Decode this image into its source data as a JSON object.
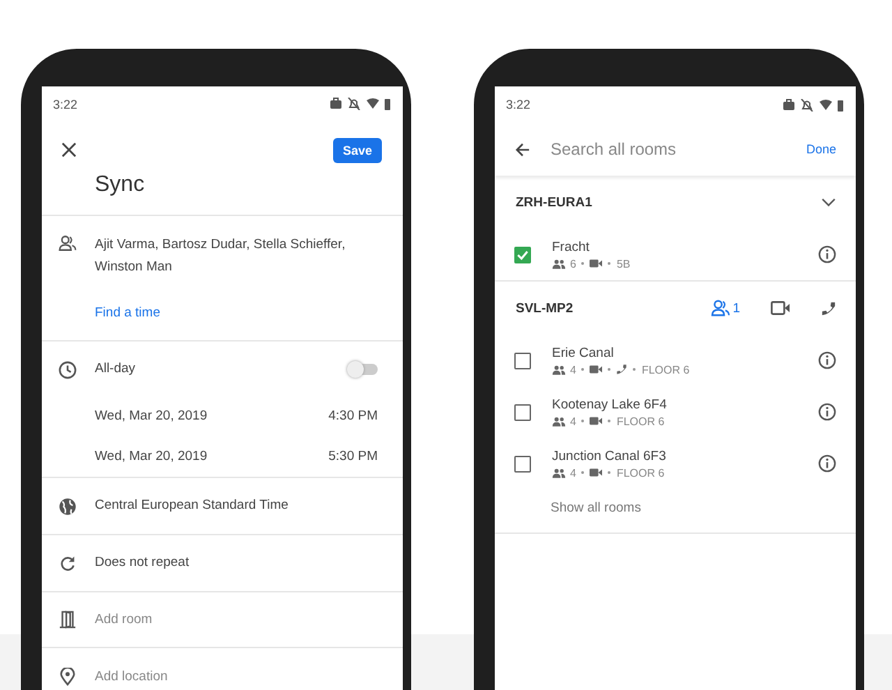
{
  "event_screen": {
    "status_time": "3:22",
    "save": "Save",
    "title": "Sync",
    "attendees": "Ajit Varma, Bartosz Dudar, Stella Schieffer, Winston Man",
    "find_time": "Find a time",
    "all_day": {
      "label": "All-day",
      "on": false
    },
    "start": {
      "date": "Wed, Mar 20, 2019",
      "time": "4:30 PM"
    },
    "end": {
      "date": "Wed, Mar 20, 2019",
      "time": "5:30 PM"
    },
    "timezone": "Central European Standard Time",
    "repeat": "Does not repeat",
    "room": {
      "placeholder": "Add room"
    },
    "location": {
      "placeholder": "Add location"
    }
  },
  "rooms_screen": {
    "status_time": "3:22",
    "search": {
      "placeholder": "Search all rooms"
    },
    "done": "Done",
    "groups": [
      {
        "name": "ZRH-EURA1",
        "kind": "collapsible",
        "rooms": [
          {
            "name": "Fracht",
            "checked": true,
            "capacity": "6",
            "video": true,
            "phone": false,
            "location": "5B"
          }
        ]
      },
      {
        "name": "SVL-MP2",
        "kind": "actions",
        "guest_count": "1",
        "rooms": [
          {
            "name": "Erie Canal",
            "checked": false,
            "capacity": "4",
            "video": true,
            "phone": true,
            "location": "FLOOR 6"
          },
          {
            "name": "Kootenay Lake 6F4",
            "checked": false,
            "capacity": "4",
            "video": true,
            "phone": false,
            "location": "FLOOR 6"
          },
          {
            "name": "Junction Canal 6F3",
            "checked": false,
            "capacity": "4",
            "video": true,
            "phone": false,
            "location": "FLOOR 6"
          }
        ],
        "show_all": "Show all rooms"
      }
    ]
  }
}
